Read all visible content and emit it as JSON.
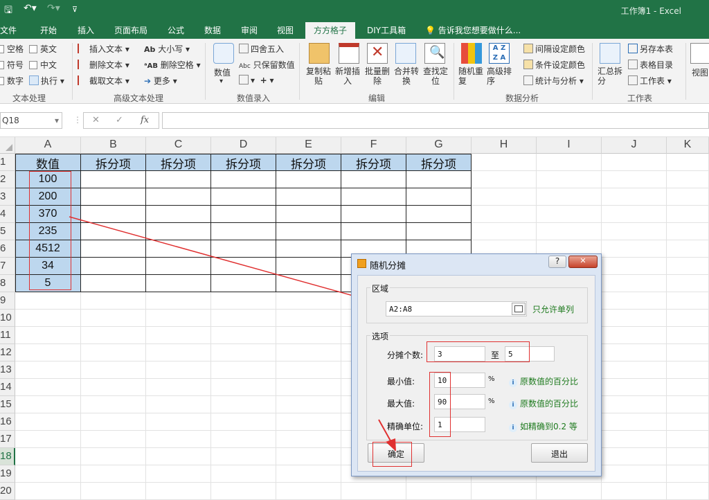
{
  "app": {
    "title": "工作簿1 - Excel",
    "qat": {
      "save": "🖫",
      "undo": "↶▾",
      "redo": "↷▾",
      "customize": "⊽"
    }
  },
  "tabs": [
    "文件",
    "开始",
    "插入",
    "页面布局",
    "公式",
    "数据",
    "审阅",
    "视图",
    "方方格子",
    "DIY工具箱"
  ],
  "tell_me": "告诉我您想要做什么...",
  "ribbon": {
    "text_group": {
      "items": [
        "空格",
        "英文",
        "符号",
        "中文",
        "数字",
        "执行"
      ],
      "label": "文本处理"
    },
    "adv_text": {
      "items": [
        "插入文本",
        "删除文本",
        "截取文本",
        "大小写",
        "删除空格",
        "更多"
      ],
      "label": "高级文本处理"
    },
    "input": {
      "value_btn": "数值",
      "round": "四舍五入",
      "keep_num": "只保留数值",
      "label": "数值录入"
    },
    "edit": {
      "buttons": [
        "复制粘\n贴",
        "新增插\n入",
        "批量删\n除",
        "合并转\n换",
        "查找定\n位"
      ],
      "label": "编辑"
    },
    "analysis": {
      "buttons": [
        "随机重\n复",
        "高级排\n序"
      ],
      "items": [
        "间隔设定颜色",
        "条件设定颜色",
        "统计与分析"
      ],
      "label": "数据分析"
    },
    "sheet": {
      "summary": "汇总拆\n分",
      "items": [
        "另存本表",
        "表格目录",
        "工作表"
      ],
      "label": "工作表"
    },
    "view": "视图"
  },
  "formula_bar": {
    "name_box": "Q18",
    "fx": "fx",
    "cancel": "✕",
    "enter": "✓",
    "value": ""
  },
  "columns": [
    "A",
    "B",
    "C",
    "D",
    "E",
    "F",
    "G",
    "H",
    "I",
    "J",
    "K"
  ],
  "rows": [
    "1",
    "2",
    "3",
    "4",
    "5",
    "6",
    "7",
    "8",
    "9",
    "10",
    "11",
    "12",
    "13",
    "14",
    "15",
    "16",
    "17",
    "18",
    "19",
    "20"
  ],
  "sheet": {
    "header_a": "数值",
    "header_split": "拆分项",
    "values": [
      "100",
      "200",
      "370",
      "235",
      "4512",
      "34",
      "5"
    ]
  },
  "dialog": {
    "title": "随机分摊",
    "help": "?",
    "close": "✕",
    "region_label": "区域",
    "range": "A2:A8",
    "single_col_note": "只允许单列",
    "options_label": "选项",
    "count_label": "分摊个数:",
    "count_from": "3",
    "count_to_label": "至",
    "count_to": "5",
    "min_label": "最小值:",
    "min_value": "10",
    "max_label": "最大值:",
    "max_value": "90",
    "percent": "%",
    "precision_label": "精确单位:",
    "precision_value": "1",
    "pct_note": "原数值的百分比",
    "precision_note": "如精确到0.2 等",
    "ok": "确定",
    "exit": "退出"
  },
  "colors": {
    "excel_green": "#217346",
    "header_fill": "#bdd7ee",
    "annotation_red": "#e03030",
    "note_green": "#1e7a1e"
  }
}
